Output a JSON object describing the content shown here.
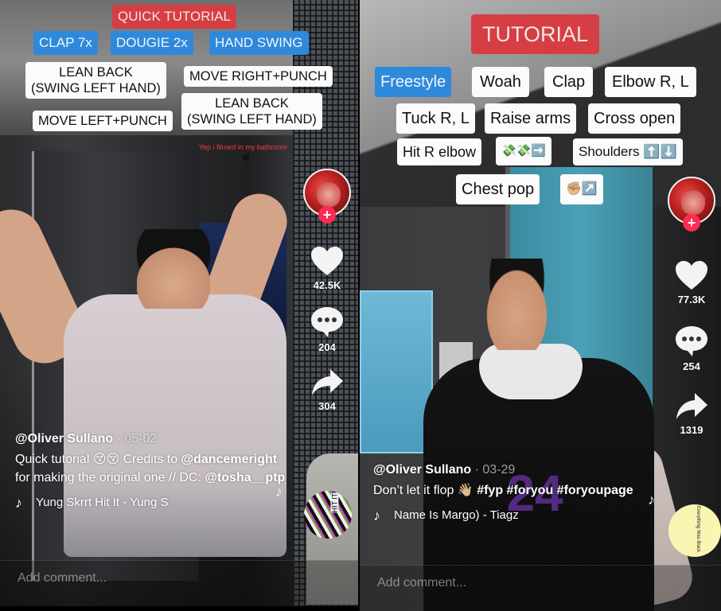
{
  "left": {
    "title_tag": "QUICK TUTORIAL",
    "blue_tags": [
      "CLAP 7x",
      "DOUGIE 2x",
      "HAND SWING"
    ],
    "white_tags": [
      "LEAN BACK\n(SWING LEFT HAND)",
      "MOVE RIGHT+PUNCH",
      "MOVE LEFT+PUNCH",
      "LEAN BACK\n(SWING LEFT HAND)"
    ],
    "overlay_note": "Yep i filmed in my bathroom",
    "overlay_emoji": "😅",
    "rail": {
      "follow_icon": "plus-icon",
      "likes": "42.5K",
      "comments": "204",
      "shares": "304"
    },
    "caption": {
      "username": "@Oliver Sullano",
      "date": " · 05-02",
      "desc_parts": [
        {
          "text": "Quick tutorial 😚😚 Credits to ",
          "bold": false
        },
        {
          "text": "@dancemeright",
          "bold": true
        },
        {
          "text": " for making the original one // DC: ",
          "bold": false
        },
        {
          "text": "@tosha__ptp",
          "bold": true
        }
      ],
      "music_track": "Yung Skrrt    Hit It - Yung S"
    },
    "disc_label": "HIT IT",
    "comment_placeholder": "Add comment..."
  },
  "right": {
    "title_tag": "TUTORIAL",
    "tags_rows": [
      [
        {
          "label": "Freestyle",
          "style": "blue"
        },
        {
          "label": "Woah",
          "style": "white"
        },
        {
          "label": "Clap",
          "style": "white"
        },
        {
          "label": "Elbow R, L",
          "style": "white"
        }
      ],
      [
        {
          "label": "Tuck R, L",
          "style": "white"
        },
        {
          "label": "Raise arms",
          "style": "white"
        },
        {
          "label": "Cross open",
          "style": "white"
        }
      ],
      [
        {
          "label": "Hit R elbow",
          "style": "white"
        },
        {
          "label": "💸💸➡️",
          "style": "white"
        },
        {
          "label": "Shoulders ⬆️⬇️",
          "style": "white"
        }
      ],
      [
        {
          "label": "Chest pop",
          "style": "white"
        },
        {
          "label": "✊🏼↗️",
          "style": "white"
        }
      ]
    ],
    "jersey_number": "24",
    "rail": {
      "follow_icon": "plus-icon",
      "likes": "77.3K",
      "comments": "254",
      "shares": "1319"
    },
    "caption": {
      "username": "@Oliver Sullano",
      "date": " · 03-29",
      "desc_parts": [
        {
          "text": "Don’t let it flop 👋🏼 ",
          "bold": false
        },
        {
          "text": "#fyp #foryou #foryoupage",
          "bold": true
        }
      ],
      "music_track": "Name Is Margo) - Tiagz"
    },
    "disc_label": "Everything Was Black",
    "comment_placeholder": "Add comment..."
  },
  "colors": {
    "title_red": "#d63e44",
    "tag_blue": "#2f89db",
    "follow_pink": "#fe2c55"
  }
}
